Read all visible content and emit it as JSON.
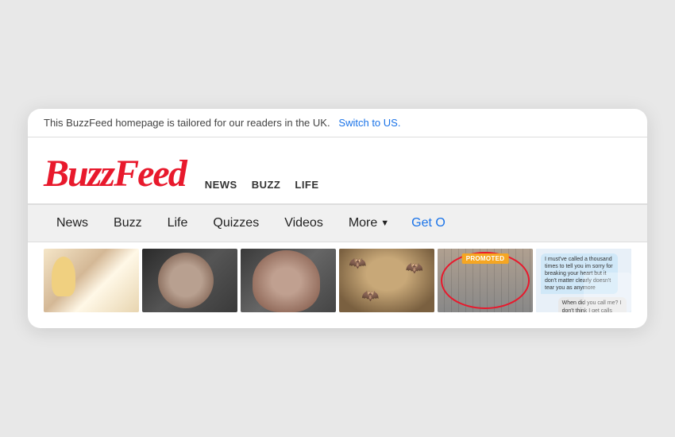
{
  "banner": {
    "text": "This BuzzFeed homepage is tailored for our readers in the UK.",
    "link_text": "Switch to US."
  },
  "logo": {
    "text": "BuzzFeed"
  },
  "header_nav": {
    "items": [
      "NEWS",
      "BUZZ",
      "LIFE"
    ]
  },
  "nav": {
    "items": [
      {
        "label": "News",
        "href": "#"
      },
      {
        "label": "Buzz",
        "href": "#"
      },
      {
        "label": "Life",
        "href": "#"
      },
      {
        "label": "Quizzes",
        "href": "#"
      },
      {
        "label": "Videos",
        "href": "#"
      },
      {
        "label": "More",
        "href": "#"
      },
      {
        "label": "Get O",
        "href": "#"
      }
    ],
    "more_label": "More",
    "get_label": "Get O"
  },
  "thumbnails": [
    {
      "id": 1,
      "type": "cartoon",
      "promoted": false
    },
    {
      "id": 2,
      "type": "person-dark",
      "promoted": false
    },
    {
      "id": 3,
      "type": "person-light",
      "promoted": false
    },
    {
      "id": 4,
      "type": "person-bats",
      "promoted": false
    },
    {
      "id": 5,
      "type": "shelves",
      "promoted": true,
      "badge": "PROMOTED"
    },
    {
      "id": 6,
      "type": "chat",
      "promoted": false
    }
  ],
  "chat": {
    "bubble1": "I must've called a thousand times to tell you im sorry for breaking your heart but it don't matter clearly doesn't tear you as anymore",
    "bubble2": "When did you call me? I don't think I get calls"
  },
  "colors": {
    "logo_red": "#e8192c",
    "link_blue": "#1a73e8",
    "nav_bg": "#f0f0f0",
    "promoted_orange": "#f5a623"
  }
}
